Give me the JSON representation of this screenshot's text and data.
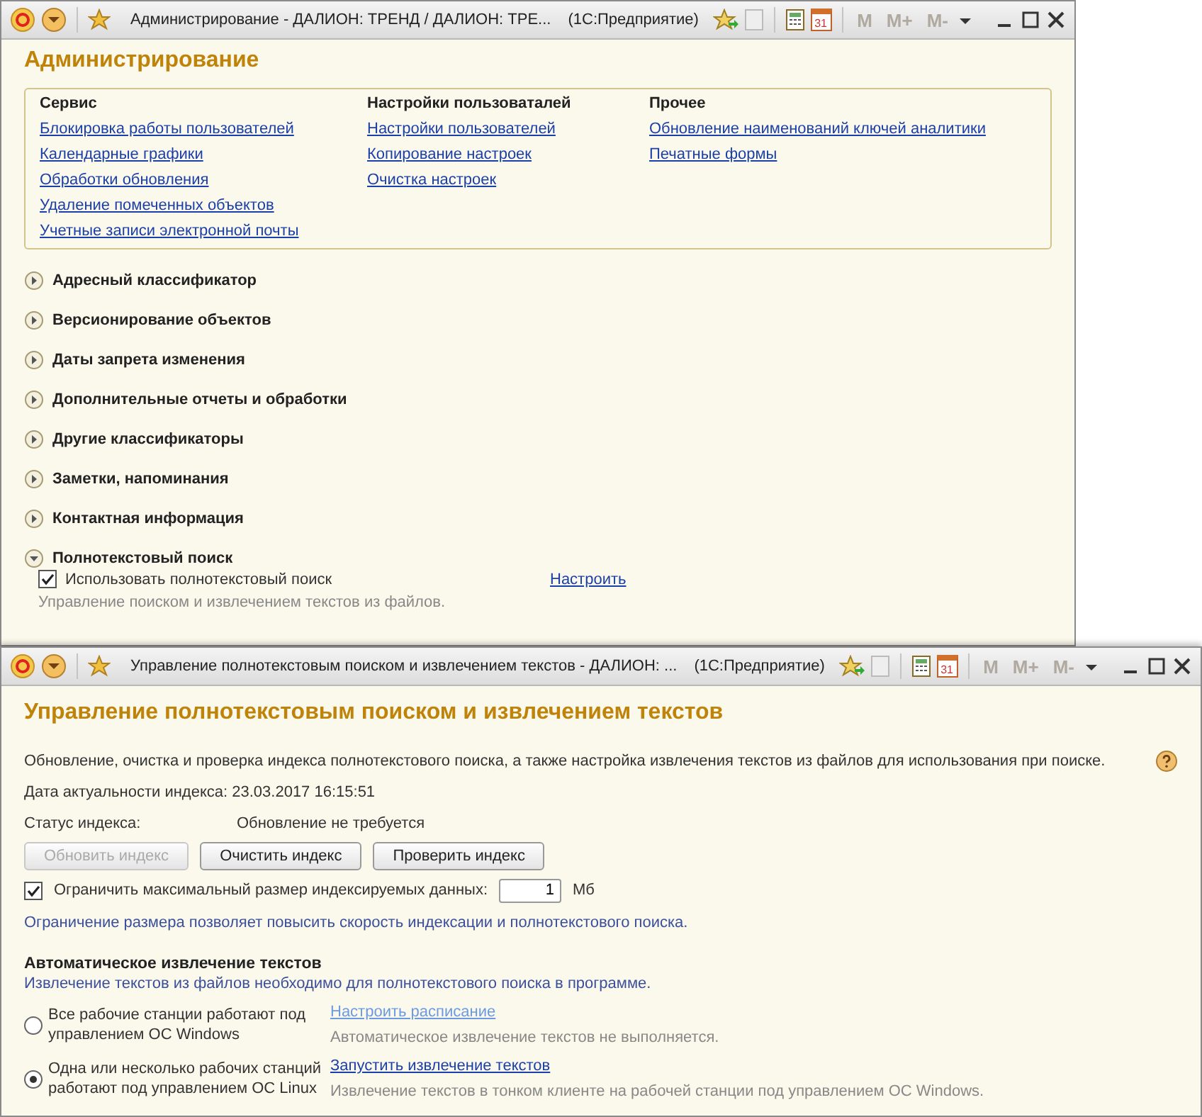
{
  "back_window": {
    "title": "Администрирование - ДАЛИОН: ТРЕНД / ДАЛИОН: ТРЕ...",
    "app_name": "(1С:Предприятие)",
    "calendar_day": "31",
    "memory_buttons": [
      "M",
      "M+",
      "M-"
    ],
    "heading": "Администрирование",
    "groups": [
      {
        "title": "Сервис",
        "links": [
          "Блокировка работы пользователей",
          "Календарные графики",
          "Обработки обновления",
          "Удаление помеченных объектов",
          "Учетные записи электронной почты"
        ]
      },
      {
        "title": "Настройки пользоваталей",
        "links": [
          "Настройки пользователей",
          "Копирование настроек",
          "Очистка настроек"
        ]
      },
      {
        "title": "Прочее",
        "links": [
          "Обновление наименований ключей аналитики",
          "Печатные формы"
        ]
      }
    ],
    "sections": [
      {
        "label": "Адресный классификатор",
        "expanded": false
      },
      {
        "label": "Версионирование объектов",
        "expanded": false
      },
      {
        "label": "Даты запрета изменения",
        "expanded": false
      },
      {
        "label": "Дополнительные отчеты и обработки",
        "expanded": false
      },
      {
        "label": "Другие классификаторы",
        "expanded": false
      },
      {
        "label": "Заметки, напоминания",
        "expanded": false
      },
      {
        "label": "Контактная информация",
        "expanded": false
      },
      {
        "label": "Полнотекстовый поиск",
        "expanded": true,
        "checkbox": {
          "label": "Использовать полнотекстовый поиск",
          "checked": true
        },
        "link": "Настроить",
        "note": "Управление поиском и извлечением текстов из файлов."
      }
    ]
  },
  "front_window": {
    "title": "Управление полнотекстовым поиском и извлечением текстов - ДАЛИОН: ...",
    "app_name": "(1С:Предприятие)",
    "calendar_day": "31",
    "memory_buttons": [
      "M",
      "M+",
      "M-"
    ],
    "heading": "Управление полнотекстовым поиском и извлечением текстов",
    "description": "Обновление, очистка и проверка индекса полнотекстового поиска, а также настройка извлечения текстов из файлов для использования при поиске.",
    "index_date": "Дата актуальности индекса: 23.03.2017 16:15:51",
    "status_label": "Статус индекса:",
    "status_value": "Обновление не требуется",
    "buttons": [
      {
        "label": "Обновить индекс",
        "disabled": true
      },
      {
        "label": "Очистить индекс",
        "disabled": false
      },
      {
        "label": "Проверить индекс",
        "disabled": false
      }
    ],
    "limit": {
      "label": "Ограничить максимальный размер индексируемых данных:",
      "checked": true,
      "value": "1",
      "unit": "Мб"
    },
    "limit_note": "Ограничение размера позволяет повысить скорость индексации и полнотекстового поиска.",
    "extraction_heading": "Автоматическое извлечение текстов",
    "extraction_note": "Извлечение текстов из файлов необходимо для полнотекстового поиска в программе.",
    "options": [
      {
        "label": "Все рабочие станции работают под управлением ОС Windows",
        "selected": false,
        "link": "Настроить расписание",
        "link_disabled": true,
        "note": "Автоматическое извлечение текстов не выполняется."
      },
      {
        "label": "Одна или несколько рабочих станций работают под управлением ОС Linux",
        "selected": true,
        "link": "Запустить извлечение текстов",
        "link_disabled": false,
        "note": "Извлечение текстов в тонком клиенте на рабочей станции под управлением ОС Windows."
      }
    ]
  }
}
